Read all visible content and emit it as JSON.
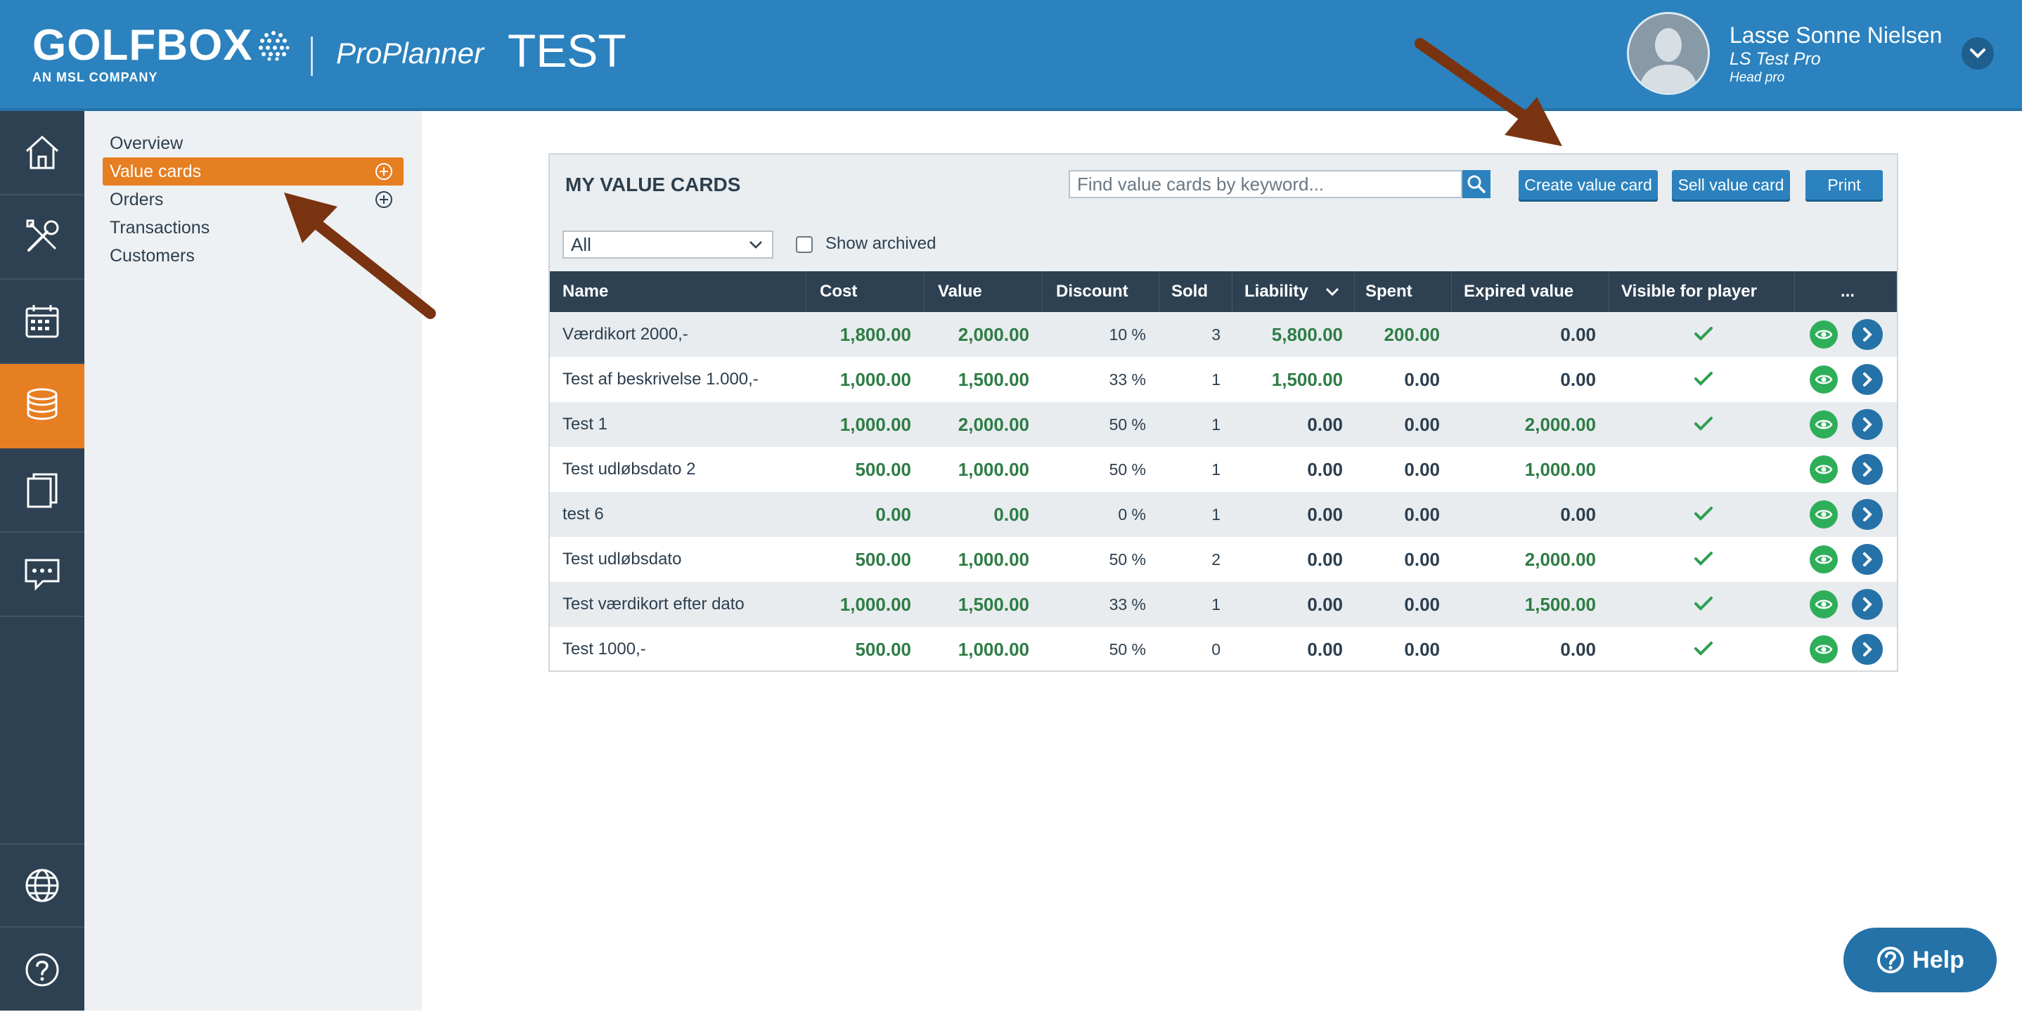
{
  "header": {
    "logo": "GOLFBOX",
    "logo_sub": "AN MSL COMPANY",
    "product": "ProPlanner",
    "environment": "TEST",
    "user": {
      "name": "Lasse Sonne Nielsen",
      "club": "LS Test Pro",
      "role": "Head pro"
    }
  },
  "icon_sidebar": [
    {
      "icon": "home-icon"
    },
    {
      "icon": "tools-icon"
    },
    {
      "icon": "calendar-icon"
    },
    {
      "icon": "coins-icon",
      "active": true
    },
    {
      "icon": "documents-icon"
    },
    {
      "icon": "chat-icon"
    },
    {
      "icon": "globe-icon"
    },
    {
      "icon": "help-circle-icon"
    }
  ],
  "subnav": {
    "items": [
      {
        "label": "Overview"
      },
      {
        "label": "Value cards",
        "active": true,
        "add": true
      },
      {
        "label": "Orders",
        "add": true
      },
      {
        "label": "Transactions"
      },
      {
        "label": "Customers"
      }
    ]
  },
  "panel": {
    "title": "MY VALUE CARDS",
    "search_placeholder": "Find value cards by keyword...",
    "buttons": {
      "create": "Create value card",
      "sell": "Sell value card",
      "print": "Print"
    },
    "filter_value": "All",
    "show_archived_label": "Show archived",
    "show_archived_checked": false
  },
  "table": {
    "columns": [
      "Name",
      "Cost",
      "Value",
      "Discount",
      "Sold",
      "Liability",
      "Spent",
      "Expired value",
      "Visible for player",
      "..."
    ],
    "rows": [
      {
        "name": "Værdikort 2000,-",
        "cost": "1,800.00",
        "value": "2,000.00",
        "discount": "10 %",
        "sold": "3",
        "liability": "5,800.00",
        "spent": "200.00",
        "expired": "0.00",
        "visible": true
      },
      {
        "name": "Test af beskrivelse 1.000,-",
        "cost": "1,000.00",
        "value": "1,500.00",
        "discount": "33 %",
        "sold": "1",
        "liability": "1,500.00",
        "spent": "0.00",
        "expired": "0.00",
        "visible": true
      },
      {
        "name": "Test 1",
        "cost": "1,000.00",
        "value": "2,000.00",
        "discount": "50 %",
        "sold": "1",
        "liability": "0.00",
        "spent": "0.00",
        "expired": "2,000.00",
        "visible": true
      },
      {
        "name": "Test udløbsdato 2",
        "cost": "500.00",
        "value": "1,000.00",
        "discount": "50 %",
        "sold": "1",
        "liability": "0.00",
        "spent": "0.00",
        "expired": "1,000.00",
        "visible": false
      },
      {
        "name": "test 6",
        "cost": "0.00",
        "value": "0.00",
        "discount": "0 %",
        "sold": "1",
        "liability": "0.00",
        "spent": "0.00",
        "expired": "0.00",
        "visible": true
      },
      {
        "name": "Test udløbsdato",
        "cost": "500.00",
        "value": "1,000.00",
        "discount": "50 %",
        "sold": "2",
        "liability": "0.00",
        "spent": "0.00",
        "expired": "2,000.00",
        "visible": true
      },
      {
        "name": "Test værdikort efter dato",
        "cost": "1,000.00",
        "value": "1,500.00",
        "discount": "33 %",
        "sold": "1",
        "liability": "0.00",
        "spent": "0.00",
        "expired": "1,500.00",
        "visible": true
      },
      {
        "name": "Test 1000,-",
        "cost": "500.00",
        "value": "1,000.00",
        "discount": "50 %",
        "sold": "0",
        "liability": "0.00",
        "spent": "0.00",
        "expired": "0.00",
        "visible": true
      }
    ]
  },
  "help_button": "Help",
  "colors": {
    "header_blue": "#2b82be",
    "sidebar_dark": "#2e4152",
    "accent_orange": "#e67e22",
    "positive_green": "#2e7d45",
    "annotation_arrow": "#7a3310"
  }
}
